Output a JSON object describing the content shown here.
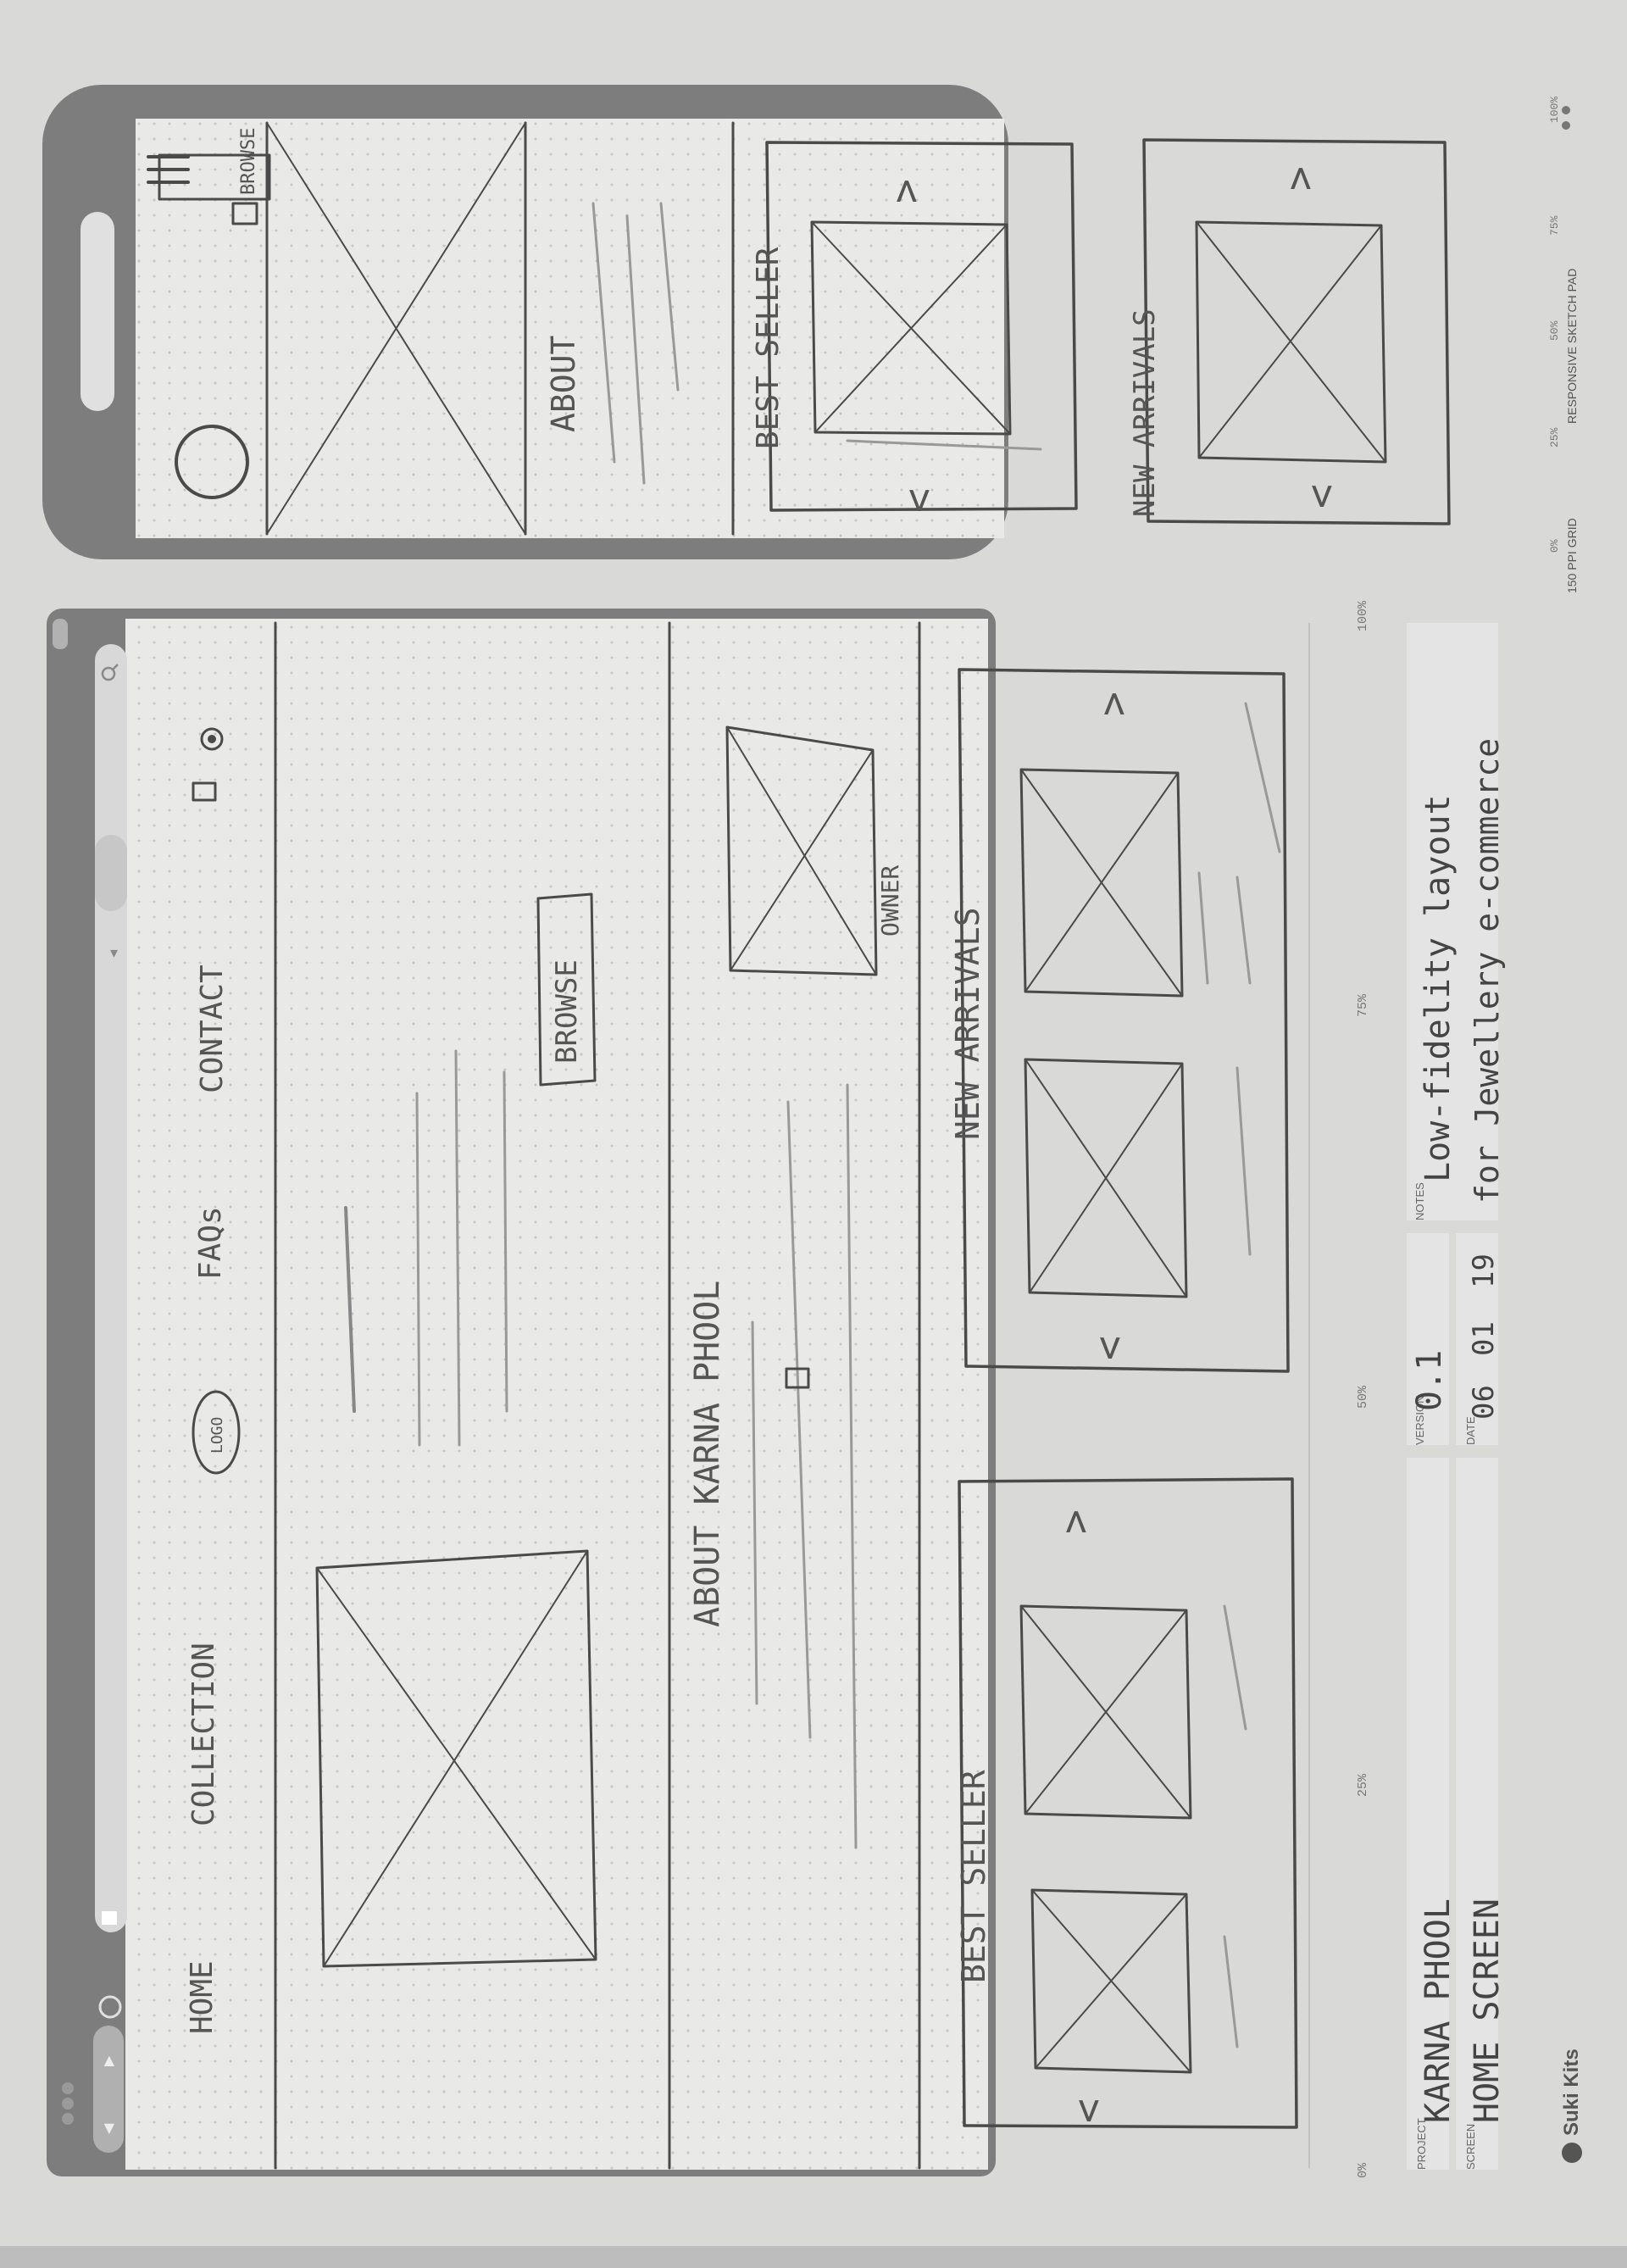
{
  "browser": {
    "nav": {
      "home": "HOME",
      "collection": "COLLECTION",
      "logo": "LOGO",
      "faqs": "FAQs",
      "contact": "CONTACT"
    },
    "hero_button": "BROWSE",
    "about_heading": "ABOUT KARNA PHOOL",
    "owner_label": "OWNER",
    "best_seller_heading": "BEST SELLER",
    "new_arrivals_heading": "NEW ARRIVALS",
    "arrow_prev": "<",
    "arrow_next": ">"
  },
  "mobile": {
    "hero_button": "BROWSE",
    "about_heading": "ABOUT",
    "best_seller_heading": "BEST SELLER",
    "new_arrivals_heading": "NEW ARRIVALS",
    "arrow_prev": "<",
    "arrow_next": ">"
  },
  "ruler": {
    "ticks": [
      "0%",
      "25%",
      "50%",
      "75%",
      "100%"
    ]
  },
  "meta": {
    "project_label": "PROJECT",
    "project_value": "KARNA PHOOL",
    "screen_label": "SCREEN",
    "screen_value": "HOME SCREEN",
    "version_label": "VERSION",
    "version_value": "0.1",
    "date_label": "DATE",
    "date_day": "06",
    "date_month": "01",
    "date_year": "19",
    "notes_label": "NOTES",
    "notes_line1": "Low-fidelity layout",
    "notes_line2": "for Jewellery e-commerce"
  },
  "footer": {
    "brand": "Suki Kits",
    "grid_info": "150 PPI GRID",
    "pad_name": "RESPONSIVE SKETCH PAD",
    "mobile_ticks": [
      "0%",
      "25%",
      "50%",
      "75%",
      "100%"
    ]
  },
  "colors": {
    "paper": "#e9e9e8",
    "frame": "#7d7d7d",
    "pencil": "#4a4a4a",
    "print": "#666666"
  }
}
